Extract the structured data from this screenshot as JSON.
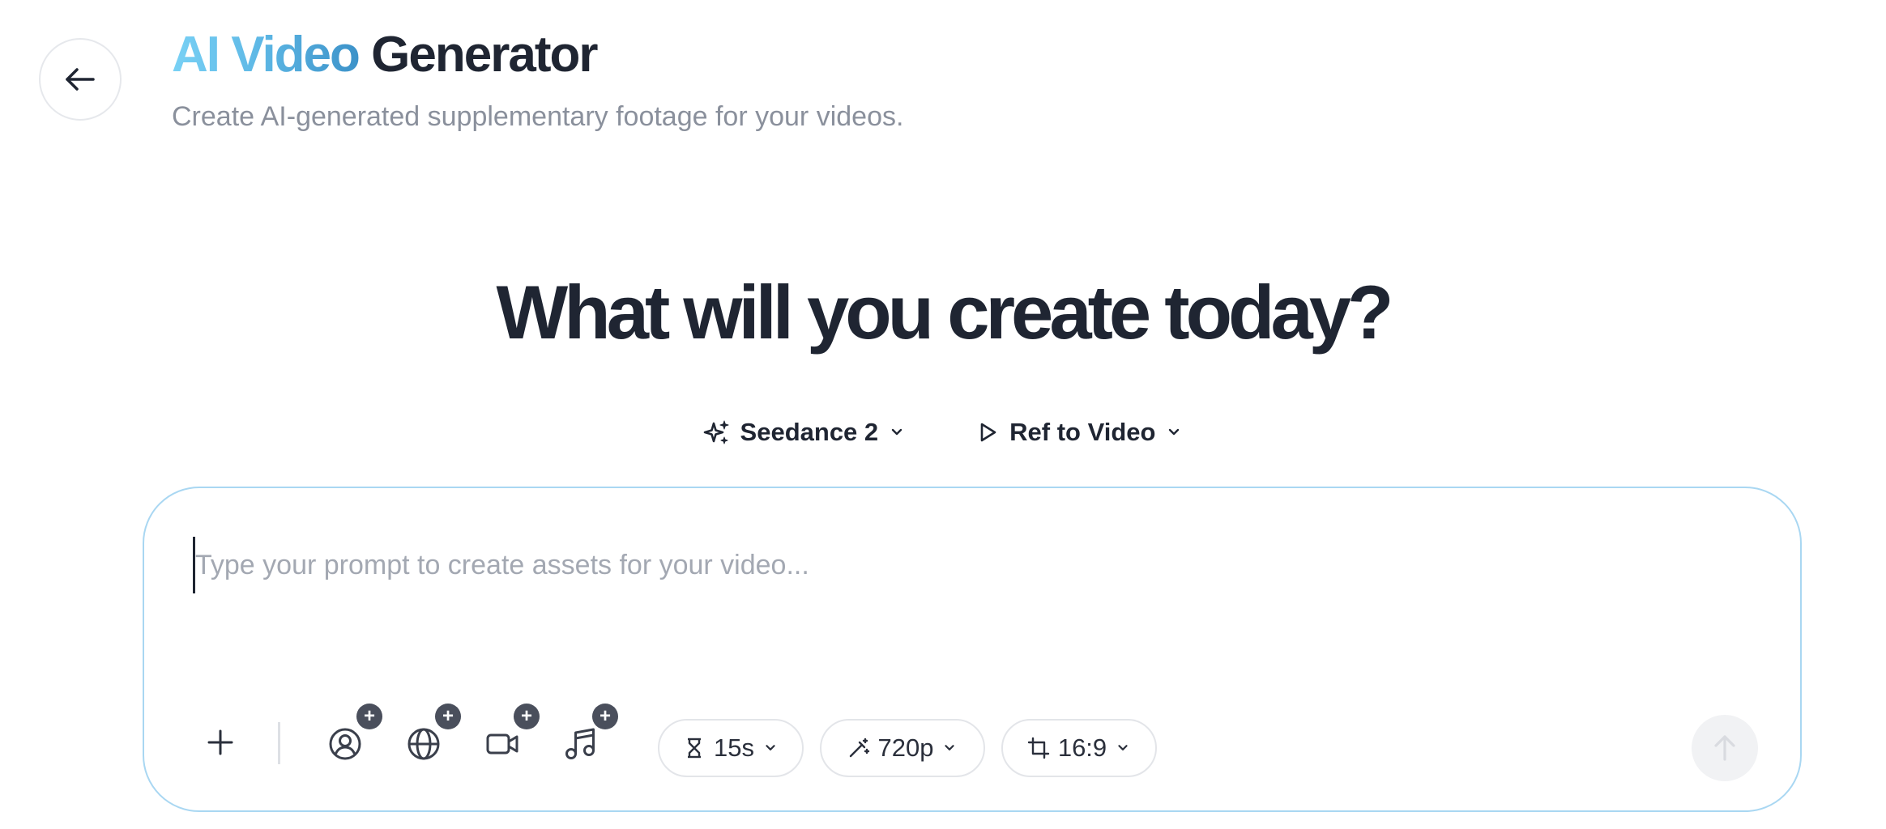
{
  "header": {
    "title_brand": "AI Video",
    "title_rest": "Generator",
    "subtitle": "Create AI-generated supplementary footage for your videos."
  },
  "hero": {
    "heading": "What will you create today?"
  },
  "selectors": {
    "model": "Seedance 2",
    "mode": "Ref to Video"
  },
  "prompt": {
    "placeholder": "Type your prompt to create assets for your video...",
    "value": ""
  },
  "toolbar": {
    "add_icon": "plus-icon",
    "assets": [
      {
        "icon": "person-icon",
        "badge": "+"
      },
      {
        "icon": "globe-icon",
        "badge": "+"
      },
      {
        "icon": "video-camera-icon",
        "badge": "+"
      },
      {
        "icon": "music-note-icon",
        "badge": "+"
      }
    ],
    "duration": "15s",
    "resolution": "720p",
    "aspect_ratio": "16:9",
    "send_icon": "arrow-up-icon"
  },
  "colors": {
    "brand_gradient_start": "#79d1f5",
    "brand_gradient_end": "#3c92c9",
    "text_dark": "#1f2532",
    "text_muted": "#8a909c",
    "prompt_border": "#a9d7f2",
    "badge_bg": "#4a4f5c"
  }
}
